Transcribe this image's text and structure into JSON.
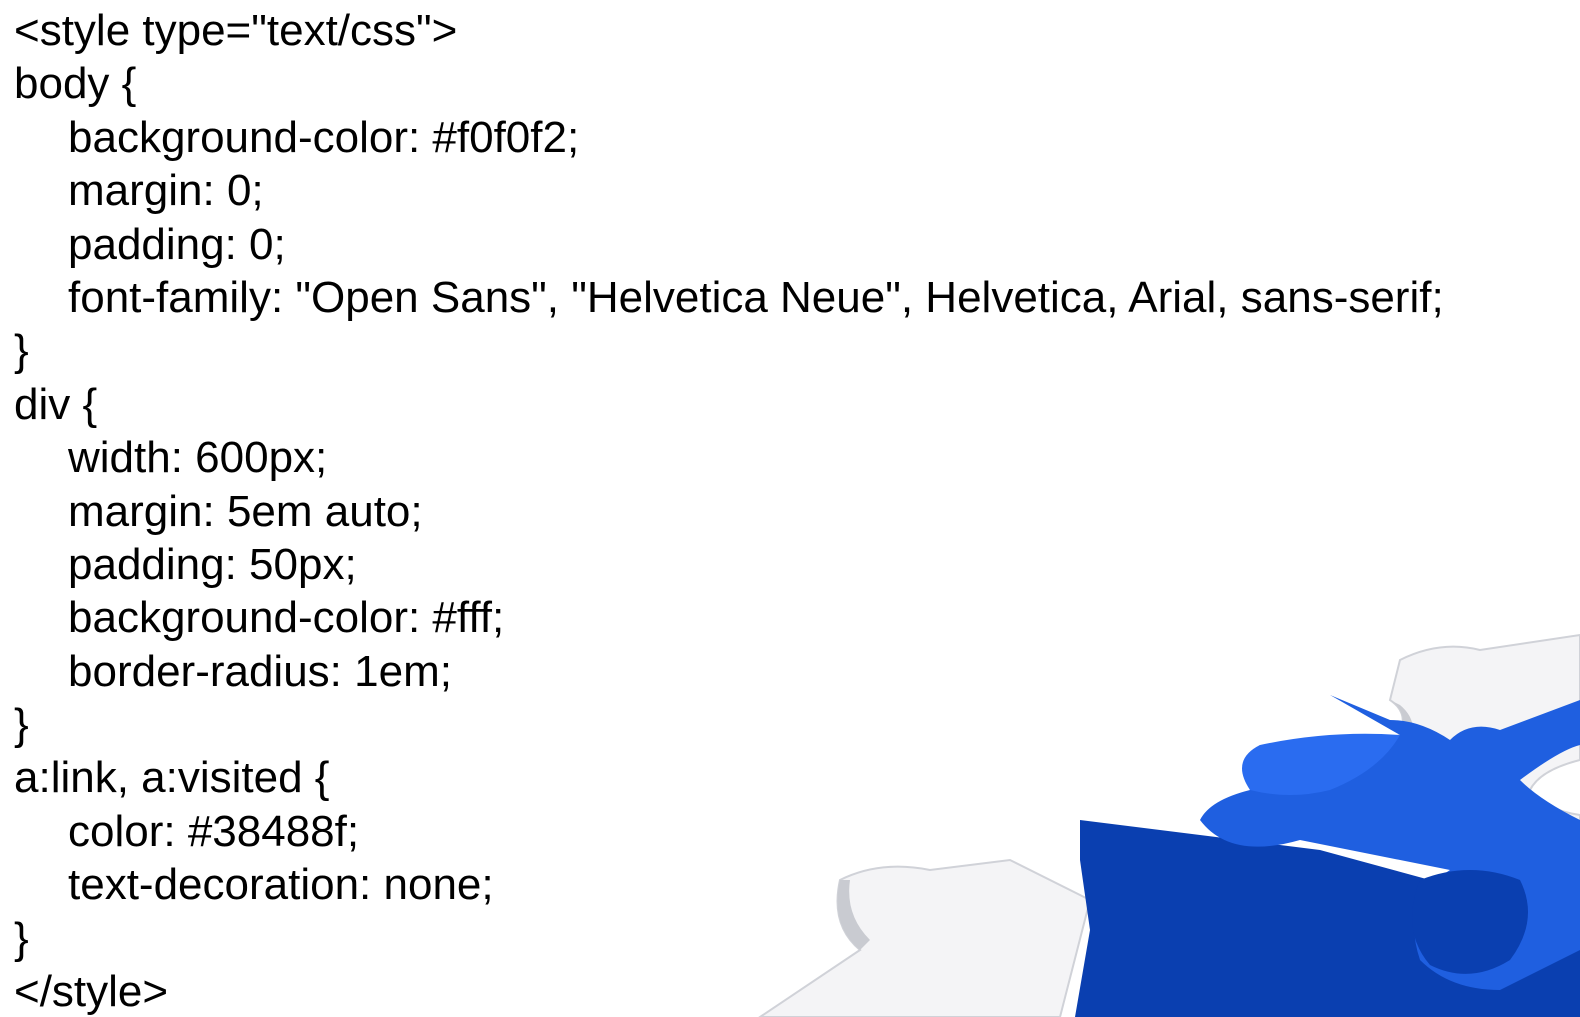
{
  "code_lines": [
    {
      "text": "<style type=\"text/css\">",
      "indent": false
    },
    {
      "text": "body {",
      "indent": false
    },
    {
      "text": "background-color: #f0f0f2;",
      "indent": true
    },
    {
      "text": "margin: 0;",
      "indent": true
    },
    {
      "text": "padding: 0;",
      "indent": true
    },
    {
      "text": "font-family: \"Open Sans\", \"Helvetica Neue\", Helvetica, Arial, sans-serif;",
      "indent": true
    },
    {
      "text": "}",
      "indent": false
    },
    {
      "text": "div {",
      "indent": false
    },
    {
      "text": "width: 600px;",
      "indent": true
    },
    {
      "text": "margin: 5em auto;",
      "indent": true
    },
    {
      "text": "padding: 50px;",
      "indent": true
    },
    {
      "text": "background-color: #fff;",
      "indent": true
    },
    {
      "text": "border-radius: 1em;",
      "indent": true
    },
    {
      "text": "}",
      "indent": false
    },
    {
      "text": "a:link, a:visited {",
      "indent": false
    },
    {
      "text": "color: #38488f;",
      "indent": true
    },
    {
      "text": "text-decoration: none;",
      "indent": true
    },
    {
      "text": "}",
      "indent": false
    },
    {
      "text": "</style>",
      "indent": false
    }
  ],
  "decoration": {
    "icon": "puzzle-pieces-icon",
    "colors": {
      "blue_piece_top": "#1f5fe0",
      "blue_piece_side": "#0a3fb0",
      "white_piece": "#f4f4f6",
      "white_piece_shadow": "#c9cbd1"
    }
  }
}
